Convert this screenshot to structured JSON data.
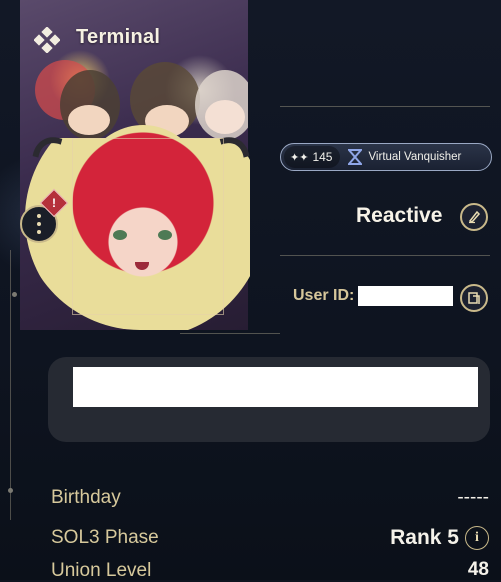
{
  "header": {
    "title": "Terminal"
  },
  "profile": {
    "badge_count": "145",
    "badge_title": "Virtual Vanquisher",
    "username": "Reactive",
    "user_id_label": "User ID:",
    "user_id_value": "",
    "bio": ""
  },
  "stats": [
    {
      "label": "Birthday",
      "value": "-----"
    },
    {
      "label": "SOL3 Phase",
      "value": "Rank 5"
    },
    {
      "label": "Union Level",
      "value": "48"
    }
  ],
  "colors": {
    "accent_gold": "#c9b98a",
    "label_gold": "#d7c99c",
    "background": "#0f141f",
    "badge_blue": "#9aa8c4",
    "alert_red": "#b5303b"
  },
  "icons": {
    "terminal": "diamond-cluster-icon",
    "menu": "vertical-dots-icon",
    "alert": "alert-diamond-icon",
    "sparkle": "sparkle-icon",
    "rank": "hourglass-icon",
    "edit": "pencil-icon",
    "copy": "copy-icon",
    "info": "info-icon"
  }
}
